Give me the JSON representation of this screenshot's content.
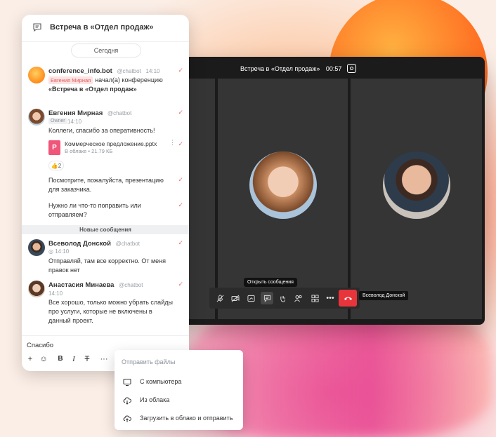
{
  "chat": {
    "title": "Встреча в «Отдел продаж»",
    "date_divider": "Сегодня",
    "new_messages_divider": "Новые сообщения",
    "messages": [
      {
        "author": "conference_info.bot",
        "handle": "@chatbot",
        "time": "14:10",
        "tag": "Евгения Мирная",
        "text_before": "начал(а) конференцию ",
        "text_bold": "«Встреча в «Отдел продаж»"
      },
      {
        "author": "Евгения Мирная",
        "handle": "@chatbot",
        "role": "Owner",
        "time": "14:10",
        "text": "Коллеги, спасибо за оперативность!",
        "file": {
          "icon_letter": "P",
          "name": "Коммерческое предложение.pptx",
          "location": "В облаке",
          "size": "• 21.79 КБ"
        },
        "reaction": "👍2",
        "text2": "Посмотрите, пожалуйста, презентацию для заказчика.",
        "text3": "Нужно ли что-то поправить или отправляем?"
      },
      {
        "author": "Всеволод Донской",
        "handle": "@chatbot",
        "time": "14:10",
        "text": "Отправляй, там все корректно. От меня правок нет"
      },
      {
        "author": "Анастасия Минаева",
        "handle": "@chatbot",
        "time": "14:10",
        "text": "Все хорошо, только можно убрать слайды про услуги, которые не включены в данный проект."
      }
    ],
    "composer_value": "Спасибо"
  },
  "call": {
    "title": "Встреча в «Отдел продаж»",
    "duration": "00:57",
    "tooltip": "Открыть сообщения",
    "active_speaker": "Всеволод Донской"
  },
  "attach_menu": {
    "title": "Отправить файлы",
    "items": [
      "С компьютера",
      "Из облака",
      "Загрузить в облако и отправить"
    ]
  },
  "colors": {
    "accent_red": "#e8343b",
    "mention_red": "#e05a5a",
    "file_pink": "#f0557a"
  }
}
